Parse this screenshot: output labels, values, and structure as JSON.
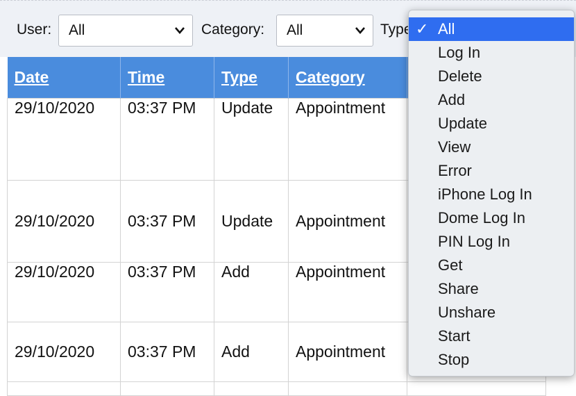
{
  "filters": {
    "user": {
      "label": "User:",
      "value": "All"
    },
    "category": {
      "label": "Category:",
      "value": "All"
    },
    "type": {
      "label": "Type",
      "value": "All"
    }
  },
  "table": {
    "headers": [
      "Date",
      "Time",
      "Type",
      "Category"
    ],
    "rows": [
      {
        "date": "29/10/2020",
        "time": "03:37 PM",
        "type": "Update",
        "category": "Appointment"
      },
      {
        "date": "29/10/2020",
        "time": "03:37 PM",
        "type": "Update",
        "category": "Appointment"
      },
      {
        "date": "29/10/2020",
        "time": "03:37 PM",
        "type": "Add",
        "category": "Appointment"
      },
      {
        "date": "29/10/2020",
        "time": "03:37 PM",
        "type": "Add",
        "category": "Appointment"
      }
    ]
  },
  "type_dropdown": {
    "selected_index": 0,
    "checkmark": "✓",
    "options": [
      "All",
      "Log In",
      "Delete",
      "Add",
      "Update",
      "View",
      "Error",
      "iPhone Log In",
      "Dome Log In",
      "PIN Log In",
      "Get",
      "Share",
      "Unshare",
      "Start",
      "Stop"
    ]
  },
  "colors": {
    "header_bg": "#4a8cdd",
    "selected_bg": "#2f6df0"
  }
}
